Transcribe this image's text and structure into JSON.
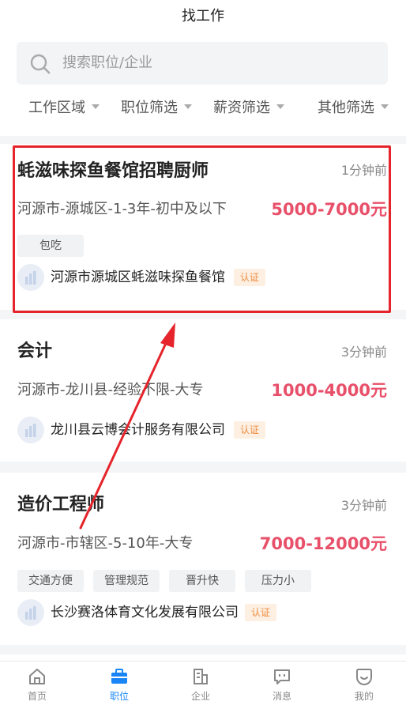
{
  "header": {
    "title": "找工作"
  },
  "search": {
    "placeholder": "搜索职位/企业"
  },
  "filters": [
    "工作区域",
    "职位筛选",
    "薪资筛选",
    "其他筛选"
  ],
  "jobs": [
    {
      "title": "蚝滋味探鱼餐馆招聘厨师",
      "time": "1分钟前",
      "meta": "河源市-源城区-1-3年-初中及以下",
      "salary": "5000-7000元",
      "tags": [
        "包吃"
      ],
      "company": "河源市源城区蚝滋味探鱼餐馆",
      "badge": "认证"
    },
    {
      "title": "会计",
      "time": "3分钟前",
      "meta": "河源市-龙川县-经验不限-大专",
      "salary": "1000-4000元",
      "tags": [],
      "company": "龙川县云博会计服务有限公司",
      "badge": "认证"
    },
    {
      "title": "造价工程师",
      "time": "3分钟前",
      "meta": "河源市-市辖区-5-10年-大专",
      "salary": "7000-12000元",
      "tags": [
        "交通方便",
        "管理规范",
        "晋升快",
        "压力小"
      ],
      "company": "长沙赛洛体育文化发展有限公司",
      "badge": "认证"
    }
  ],
  "tabbar": {
    "items": [
      {
        "label": "首页",
        "icon": "home-icon"
      },
      {
        "label": "职位",
        "icon": "briefcase-icon",
        "active": true
      },
      {
        "label": "企业",
        "icon": "building-icon"
      },
      {
        "label": "消息",
        "icon": "message-icon"
      },
      {
        "label": "我的",
        "icon": "profile-icon"
      }
    ]
  },
  "colors": {
    "accent": "#1a86f5",
    "salary": "#e8506a",
    "badge_bg": "#fdf0e2",
    "badge_text": "#f08a3c",
    "annotation": "#e5242b"
  }
}
